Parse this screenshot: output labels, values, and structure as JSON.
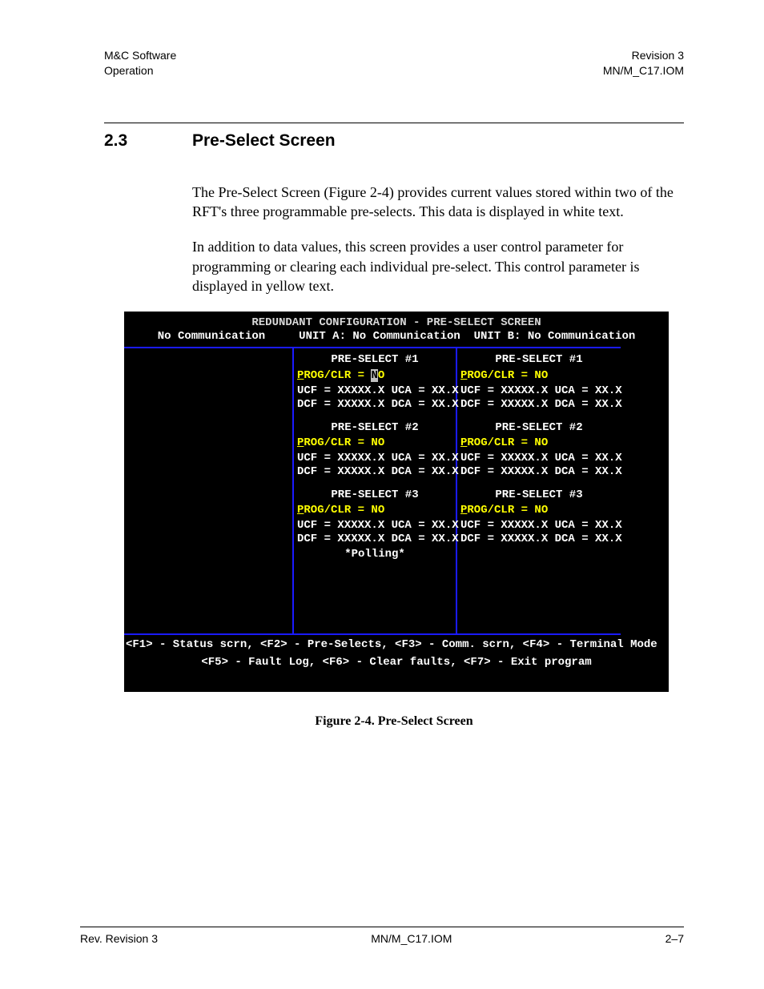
{
  "header": {
    "left1": "M&C Software",
    "left2": "Operation",
    "right1": "Revision 3",
    "right2": "MN/M_C17.IOM"
  },
  "section": {
    "number": "2.3",
    "title": "Pre-Select Screen"
  },
  "para1": "The Pre-Select Screen (Figure 2-4) provides current values stored within two of the RFT's three programmable pre-selects. This data is displayed in white text.",
  "para2": "In addition to data values, this screen provides a user control parameter for programming or clearing each individual pre-select. This control parameter is displayed in yellow text.",
  "term": {
    "title": "REDUNDANT CONFIGURATION - PRE-SELECT SCREEN",
    "status": "No Communication     UNIT A: No Communication  UNIT B: No Communication",
    "unitA": {
      "ps1": {
        "title": "PRE-SELECT #1",
        "prog_prefix": "P",
        "prog_rest": "ROG/CLR =",
        "value_pre": "N",
        "value_post": "O",
        "ucf": "UCF = XXXXX.X UCA = XX.X",
        "dcf": "DCF = XXXXX.X DCA = XX.X"
      },
      "ps2": {
        "title": "PRE-SELECT #2",
        "prog_prefix": "P",
        "prog_rest": "ROG/CLR = NO",
        "ucf": "UCF = XXXXX.X UCA = XX.X",
        "dcf": "DCF = XXXXX.X DCA = XX.X"
      },
      "ps3": {
        "title": "PRE-SELECT #3",
        "prog_prefix": "P",
        "prog_rest": "ROG/CLR = NO",
        "ucf": "UCF = XXXXX.X UCA = XX.X",
        "dcf": "DCF = XXXXX.X DCA = XX.X"
      }
    },
    "unitB": {
      "ps1": {
        "title": "PRE-SELECT #1",
        "prog_prefix": "P",
        "prog_rest": "ROG/CLR = NO",
        "ucf": "UCF = XXXXX.X UCA = XX.X",
        "dcf": "DCF = XXXXX.X DCA = XX.X"
      },
      "ps2": {
        "title": "PRE-SELECT #2",
        "prog_prefix": "P",
        "prog_rest": "ROG/CLR = NO",
        "ucf": "UCF = XXXXX.X UCA = XX.X",
        "dcf": "DCF = XXXXX.X DCA = XX.X"
      },
      "ps3": {
        "title": "PRE-SELECT #3",
        "prog_prefix": "P",
        "prog_rest": "ROG/CLR = NO",
        "ucf": "UCF = XXXXX.X UCA = XX.X",
        "dcf": "DCF = XXXXX.X DCA = XX.X"
      }
    },
    "polling": "*Polling*",
    "fkeys1": "<F1> - Status scrn, <F2> - Pre-Selects, <F3> - Comm. scrn, <F4> - Terminal Mode",
    "fkeys2": "<F5> - Fault Log, <F6> - Clear faults, <F7> - Exit program"
  },
  "caption": "Figure 2-4.  Pre-Select Screen",
  "footer": {
    "left": "Rev. Revision 3",
    "center": "MN/M_C17.IOM",
    "right": "2–7"
  }
}
